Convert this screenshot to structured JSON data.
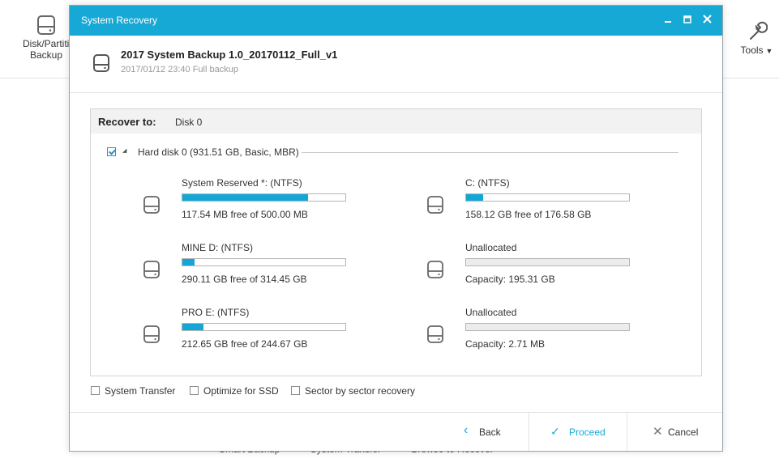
{
  "background": {
    "disk_partition_label": "Disk/Partition Backup",
    "tools_label": "Tools",
    "bottom_items": [
      "Smart Backup",
      "System Transfer",
      "Browse to Recover"
    ]
  },
  "dialog": {
    "title": "System Recovery",
    "backup_name": "2017 System Backup 1.0_20170112_Full_v1",
    "backup_meta": "2017/01/12 23:40 Full backup",
    "recover_to_label": "Recover to:",
    "recover_to_value": "Disk 0",
    "hard_disk_label": "Hard disk 0 (931.51 GB, Basic, MBR)",
    "hard_disk_checked": true,
    "partitions": [
      {
        "name": "System Reserved *: (NTFS)",
        "info": "117.54 MB free of 500.00 MB",
        "used_fraction": 0.77,
        "unallocated": false
      },
      {
        "name": "C: (NTFS)",
        "info": "158.12 GB free of 176.58 GB",
        "used_fraction": 0.105,
        "unallocated": false
      },
      {
        "name": "MINE D: (NTFS)",
        "info": "290.11 GB free of 314.45 GB",
        "used_fraction": 0.077,
        "unallocated": false
      },
      {
        "name": "Unallocated",
        "info": "Capacity: 195.31 GB",
        "used_fraction": 0,
        "unallocated": true
      },
      {
        "name": "PRO E: (NTFS)",
        "info": "212.65 GB free of 244.67 GB",
        "used_fraction": 0.131,
        "unallocated": false
      },
      {
        "name": "Unallocated",
        "info": "Capacity: 2.71 MB",
        "used_fraction": 0,
        "unallocated": true
      }
    ],
    "options": [
      {
        "label": "System Transfer",
        "checked": false
      },
      {
        "label": "Optimize for SSD",
        "checked": false
      },
      {
        "label": "Sector by sector recovery",
        "checked": false
      }
    ],
    "buttons": {
      "back": "Back",
      "proceed": "Proceed",
      "cancel": "Cancel"
    }
  },
  "colors": {
    "accent": "#17a9d6",
    "bar_fill": "#16a6d5"
  }
}
